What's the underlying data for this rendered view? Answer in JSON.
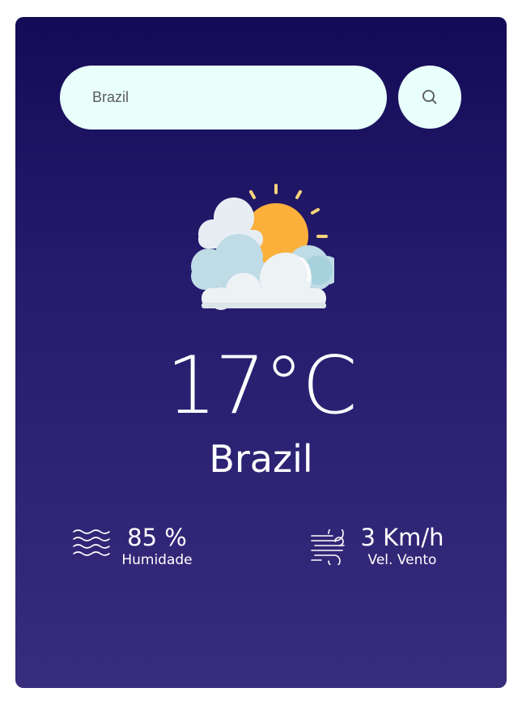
{
  "search": {
    "value": "Brazil",
    "button_icon": "search-icon"
  },
  "weather": {
    "icon": "partly-cloudy-icon",
    "temperature": "17°C",
    "city": "Brazil"
  },
  "stats": {
    "humidity": {
      "value": "85 %",
      "label": "Humidade",
      "icon": "humidity-waves-icon"
    },
    "wind": {
      "value": "3 Km/h",
      "label": "Vel. Vento",
      "icon": "wind-icon"
    }
  },
  "colors": {
    "card_top": "#140b57",
    "card_bottom": "#382c7c",
    "input_bg": "#e8fffb",
    "text": "#ffffff"
  }
}
